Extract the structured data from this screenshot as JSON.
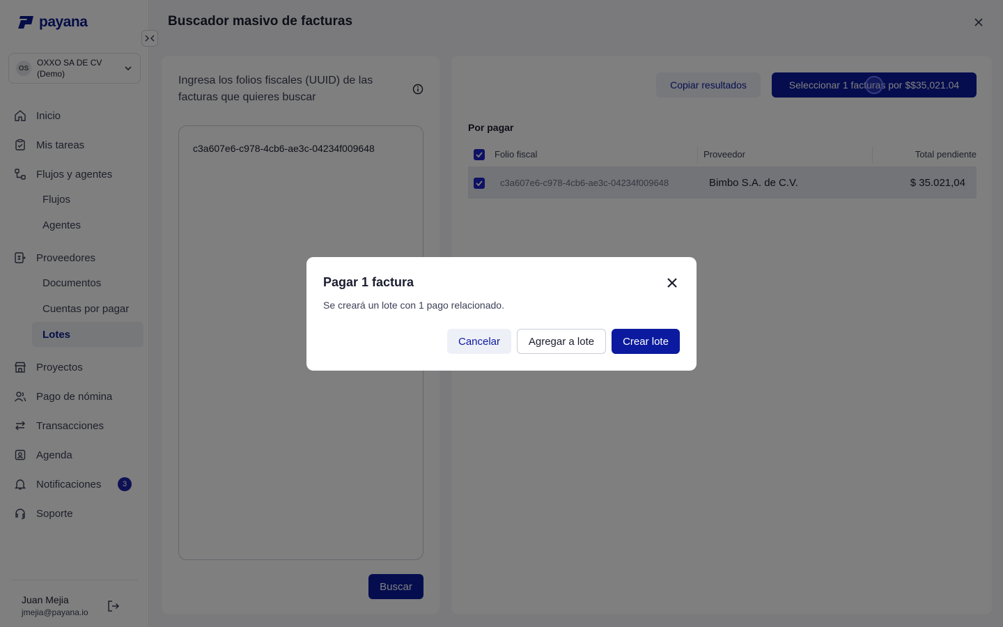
{
  "brand": {
    "name": "payana",
    "color": "#0b1a8f"
  },
  "company": {
    "initials": "OS",
    "name": "OXXO SA DE CV (Demo)"
  },
  "nav": {
    "items": [
      {
        "label": "Inicio",
        "icon": "home-icon"
      },
      {
        "label": "Mis tareas",
        "icon": "clipboard-icon"
      },
      {
        "label": "Flujos y agentes",
        "icon": "flow-icon"
      },
      {
        "label": "Proveedores",
        "icon": "invoice-icon"
      },
      {
        "label": "Proyectos",
        "icon": "store-icon"
      },
      {
        "label": "Pago de nómina",
        "icon": "users-icon"
      },
      {
        "label": "Transacciones",
        "icon": "arrows-icon"
      },
      {
        "label": "Agenda",
        "icon": "contacts-icon"
      },
      {
        "label": "Notificaciones",
        "icon": "bell-icon",
        "badge": "3"
      },
      {
        "label": "Soporte",
        "icon": "headset-icon"
      }
    ],
    "sub_flujos": [
      "Flujos",
      "Agentes"
    ],
    "sub_proveedores": [
      "Documentos",
      "Cuentas por pagar",
      "Lotes"
    ],
    "active": "Lotes"
  },
  "user": {
    "name": "Juan Mejia",
    "email": "jmejia@payana.io"
  },
  "main": {
    "title": "Buscador masivo de facturas",
    "left": {
      "heading": "Ingresa los folios fiscales (UUID) de las facturas que quieres buscar",
      "textarea_value": "c3a607e6-c978-4cb6-ae3c-04234f009648",
      "search_label": "Buscar"
    },
    "right": {
      "copy_label": "Copiar resultados",
      "select_label": "Seleccionar 1 facturas por $$35,021.04",
      "section": "Por pagar",
      "columns": [
        "Folio fiscal",
        "Proveedor",
        "Total pendiente"
      ],
      "rows": [
        {
          "uuid": "c3a607e6-c978-4cb6-ae3c-04234f009648",
          "proveedor": "Bimbo S.A. de C.V.",
          "total": "$ 35.021,04",
          "checked": true
        }
      ]
    }
  },
  "modal": {
    "title": "Pagar 1 factura",
    "description": "Se creará un lote con 1 pago relacionado.",
    "cancel": "Cancelar",
    "add": "Agregar a lote",
    "create": "Crear lote"
  }
}
